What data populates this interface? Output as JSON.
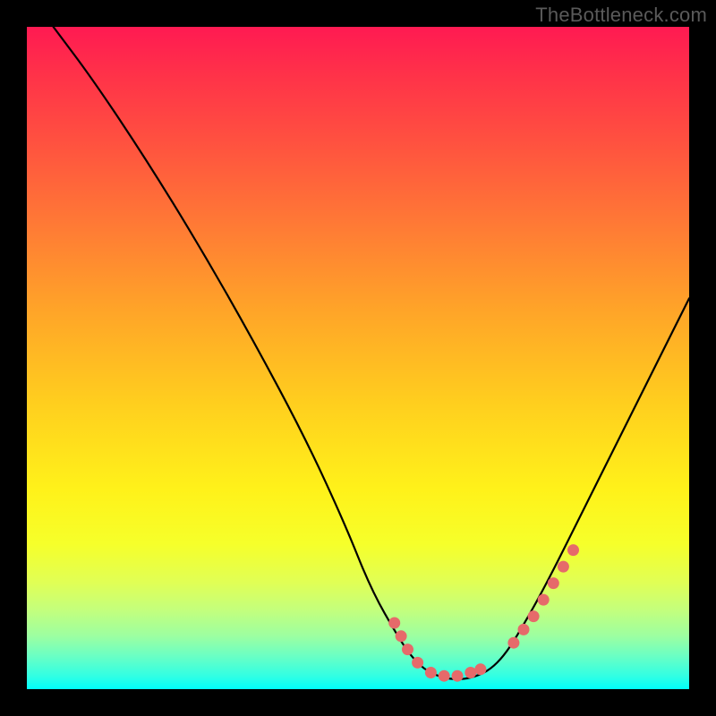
{
  "watermark": "TheBottleneck.com",
  "chart_data": {
    "type": "line",
    "title": "",
    "xlabel": "",
    "ylabel": "",
    "xlim": [
      0,
      100
    ],
    "ylim": [
      0,
      100
    ],
    "series": [
      {
        "name": "curve",
        "x": [
          4,
          10,
          18,
          26,
          34,
          42,
          48,
          52,
          56,
          58,
          60,
          62,
          64,
          66,
          68,
          70,
          72,
          74,
          78,
          84,
          90,
          96,
          100
        ],
        "y": [
          100,
          92,
          80,
          67,
          53,
          38,
          25,
          15,
          8,
          5,
          3,
          2,
          1.5,
          1.5,
          2,
          3,
          5,
          8,
          15,
          27,
          39,
          51,
          59
        ]
      },
      {
        "name": "dots-left-cluster",
        "x": [
          55.5,
          56.5,
          57.5,
          59,
          61,
          63,
          65,
          67,
          68.5
        ],
        "y": [
          10,
          8,
          6,
          4,
          2.5,
          2,
          2,
          2.5,
          3
        ]
      },
      {
        "name": "dots-right-cluster",
        "x": [
          73.5,
          75,
          76.5,
          78,
          79.5,
          81,
          82.5
        ],
        "y": [
          7,
          9,
          11,
          13.5,
          16,
          18.5,
          21
        ]
      }
    ],
    "gradient_stops": [
      {
        "pos": 0,
        "color": "#ff1a52"
      },
      {
        "pos": 50,
        "color": "#ffcf1e"
      },
      {
        "pos": 85,
        "color": "#e0ff56"
      },
      {
        "pos": 100,
        "color": "#00fffb"
      }
    ]
  }
}
